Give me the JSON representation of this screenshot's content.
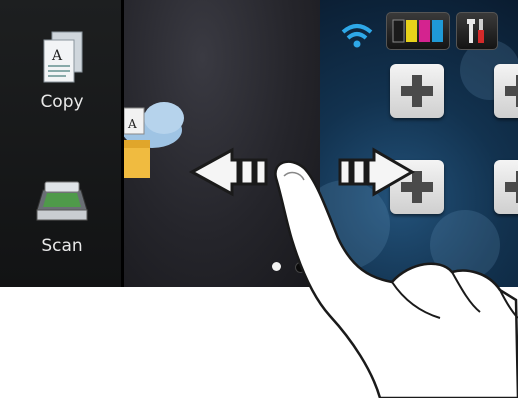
{
  "apps": [
    {
      "label": "Copy",
      "icon": "copy-icon"
    },
    {
      "label": "Scan",
      "icon": "scan-icon"
    }
  ],
  "status_bar": {
    "wifi_icon": "wifi-icon",
    "ink_icon": "ink-cartridge-icon",
    "tools_icon": "tools-icon"
  },
  "page_indicator": {
    "pages": 2,
    "current": 1
  },
  "colors": {
    "ink": [
      "#1a1a1a",
      "#e8d21a",
      "#d4238f",
      "#1f9ad6"
    ],
    "wifi": "#2ea8e8"
  }
}
